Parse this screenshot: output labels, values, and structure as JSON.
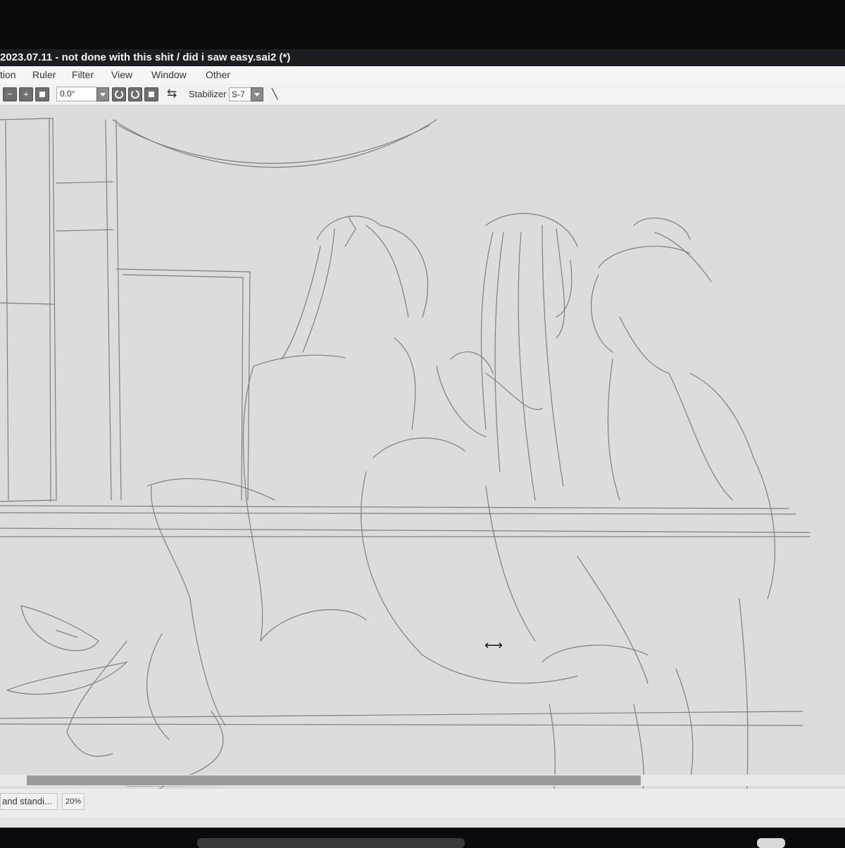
{
  "window": {
    "title": "2023.07.11 - not done with this shit / did i saw easy.sai2 (*)"
  },
  "menu": {
    "items": [
      "tion",
      "Ruler",
      "Filter",
      "View",
      "Window",
      "Other"
    ]
  },
  "toolbar": {
    "angle_value": "0.0°",
    "stabilizer_label": "Stabilizer",
    "stabilizer_value": "S-7",
    "minus_glyph": "−",
    "plus_glyph": "+",
    "swap_glyph": "⇆",
    "pen_glyph": "╲"
  },
  "status": {
    "file_label": "and standi...",
    "zoom": "20%"
  },
  "cursor": {
    "glyph": "⟷"
  },
  "colors": {
    "titlebar": "#1b1d22",
    "canvas": "#dcdcdc",
    "sketch_line": "#7a7a7a",
    "scroll_thumb": "#9a9a9a"
  },
  "icons": {
    "rotate_left": "rotate-left-icon",
    "rotate_right": "rotate-right-icon",
    "reset": "reset-icon",
    "flip": "flip-icon",
    "pen": "pen-icon"
  }
}
